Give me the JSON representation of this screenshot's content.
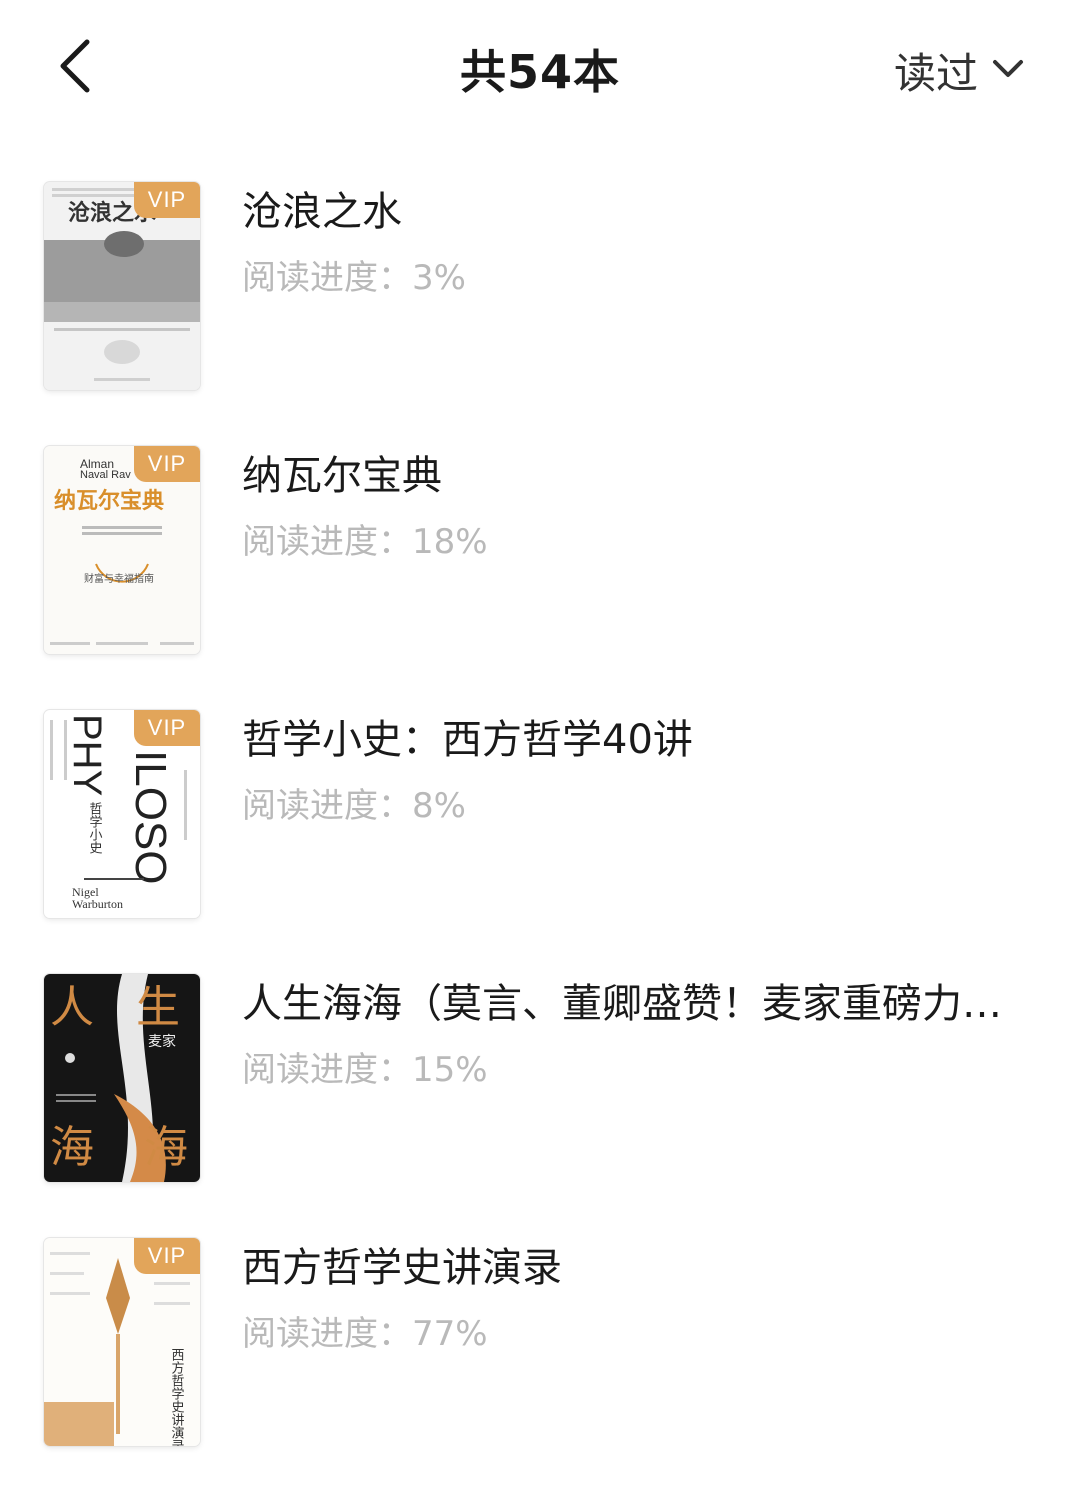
{
  "header": {
    "title": "共54本",
    "filter_label": "读过",
    "back_icon": "chevron-left-icon",
    "filter_icon": "chevron-down-icon"
  },
  "colors": {
    "vip_badge": "#e2a55a",
    "title_text": "#1a1a1a",
    "progress_text": "#b9b9b9"
  },
  "books": [
    {
      "title": "沧浪之水",
      "progress_label": "阅读进度：3%",
      "progress": 0.03,
      "vip": "VIP",
      "cover_text": {
        "title": "沧浪之水"
      }
    },
    {
      "title": "纳瓦尔宝典",
      "progress_label": "阅读进度：18%",
      "progress": 0.18,
      "vip": "VIP",
      "cover_text": {
        "title": "纳瓦尔宝典",
        "subtitle": "财富与幸福指南",
        "en": "The Almanack of Naval Ravikant"
      }
    },
    {
      "title": "哲学小史：西方哲学40讲",
      "progress_label": "阅读进度：8%",
      "progress": 0.08,
      "vip": "VIP",
      "cover_text": {
        "big": "PHILOSO",
        "cn": "哲学小史",
        "author": "Nigel Warburton"
      }
    },
    {
      "title": "人生海海（莫言、董卿盛赞！麦家重磅力…",
      "progress_label": "阅读进度：15%",
      "progress": 0.15,
      "vip": "",
      "cover_text": {
        "tl": "人",
        "tr": "生",
        "bl": "海",
        "br": "海",
        "author": "麦家"
      }
    },
    {
      "title": "西方哲学史讲演录",
      "progress_label": "阅读进度：77%",
      "progress": 0.77,
      "vip": "VIP",
      "cover_text": {
        "title": "西方哲学史讲演录"
      }
    }
  ]
}
